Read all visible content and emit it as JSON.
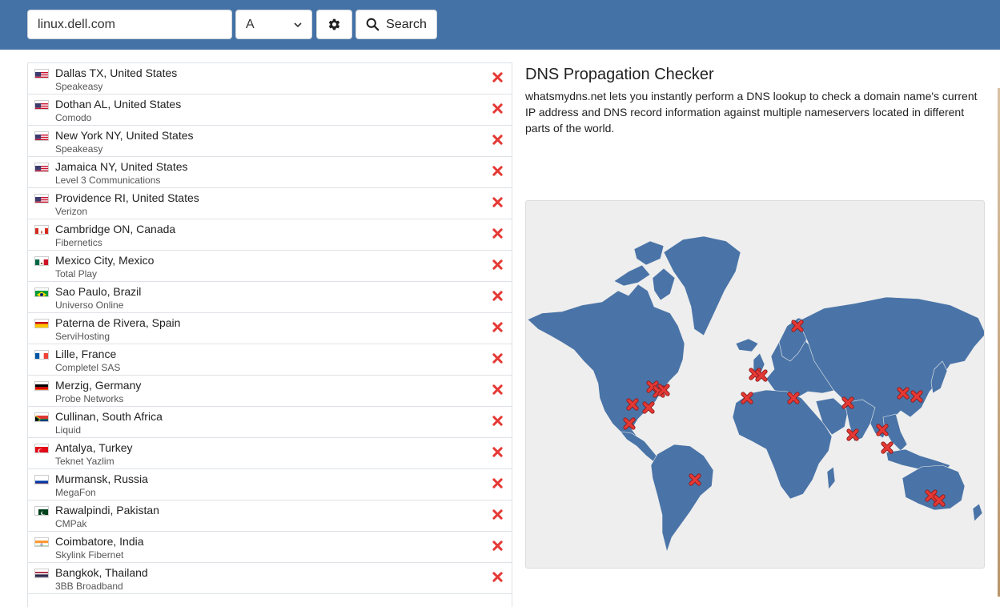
{
  "search": {
    "domain": "linux.dell.com",
    "record_type": "A",
    "search_label": "Search"
  },
  "icons": {
    "settings": "gear-icon",
    "search": "magnifier-icon",
    "status_fail": "red-x-icon",
    "dropdown": "chevron-down-icon"
  },
  "colors": {
    "header": "#4472a6",
    "map_land": "#4a74a7",
    "fail_marker": "#e53935"
  },
  "results": [
    {
      "location": "Dallas TX, United States",
      "provider": "Speakeasy",
      "flag": "us",
      "status": "fail"
    },
    {
      "location": "Dothan AL, United States",
      "provider": "Comodo",
      "flag": "us",
      "status": "fail"
    },
    {
      "location": "New York NY, United States",
      "provider": "Speakeasy",
      "flag": "us",
      "status": "fail"
    },
    {
      "location": "Jamaica NY, United States",
      "provider": "Level 3 Communications",
      "flag": "us",
      "status": "fail"
    },
    {
      "location": "Providence RI, United States",
      "provider": "Verizon",
      "flag": "us",
      "status": "fail"
    },
    {
      "location": "Cambridge ON, Canada",
      "provider": "Fibernetics",
      "flag": "ca",
      "status": "fail"
    },
    {
      "location": "Mexico City, Mexico",
      "provider": "Total Play",
      "flag": "mx",
      "status": "fail"
    },
    {
      "location": "Sao Paulo, Brazil",
      "provider": "Universo Online",
      "flag": "br",
      "status": "fail"
    },
    {
      "location": "Paterna de Rivera, Spain",
      "provider": "ServiHosting",
      "flag": "es",
      "status": "fail"
    },
    {
      "location": "Lille, France",
      "provider": "Completel SAS",
      "flag": "fr",
      "status": "fail"
    },
    {
      "location": "Merzig, Germany",
      "provider": "Probe Networks",
      "flag": "de",
      "status": "fail"
    },
    {
      "location": "Cullinan, South Africa",
      "provider": "Liquid",
      "flag": "za",
      "status": "fail"
    },
    {
      "location": "Antalya, Turkey",
      "provider": "Teknet Yazlim",
      "flag": "tr",
      "status": "fail"
    },
    {
      "location": "Murmansk, Russia",
      "provider": "MegaFon",
      "flag": "ru",
      "status": "fail"
    },
    {
      "location": "Rawalpindi, Pakistan",
      "provider": "CMPak",
      "flag": "pk",
      "status": "fail"
    },
    {
      "location": "Coimbatore, India",
      "provider": "Skylink Fibernet",
      "flag": "in",
      "status": "fail"
    },
    {
      "location": "Bangkok, Thailand",
      "provider": "3BB Broadband",
      "flag": "th",
      "status": "fail"
    }
  ],
  "info": {
    "title": "DNS Propagation Checker",
    "description": "whatsmydns.net lets you instantly perform a DNS lookup to check a domain name's current IP address and DNS record information against multiple nameservers located in different parts of the world."
  }
}
